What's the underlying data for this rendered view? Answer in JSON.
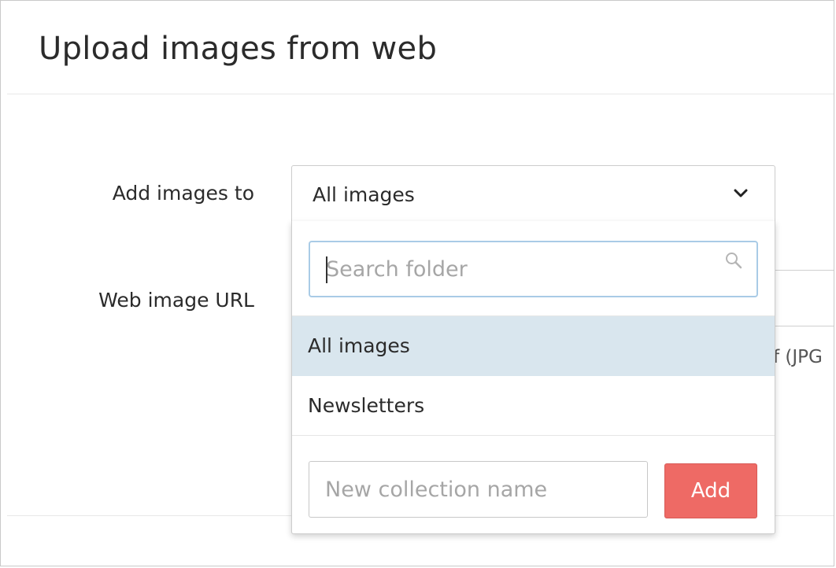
{
  "modal": {
    "title": "Upload images from web"
  },
  "form": {
    "add_to_label": "Add images to",
    "url_label": "Web image URL",
    "helper_text_fragment": "gif (JPG"
  },
  "select": {
    "value": "All images",
    "icon": "chevron-down-icon"
  },
  "dropdown": {
    "search": {
      "placeholder": "Search folder",
      "value": "",
      "icon": "search-icon"
    },
    "options": [
      {
        "label": "All images",
        "selected": true
      },
      {
        "label": "Newsletters",
        "selected": false
      }
    ],
    "new_collection": {
      "placeholder": "New collection name",
      "value": ""
    },
    "add_button_label": "Add"
  },
  "colors": {
    "accent_button": "#ee6a65",
    "selected_option_bg": "#d9e6ee",
    "search_focus_border": "#a9cbe6"
  }
}
